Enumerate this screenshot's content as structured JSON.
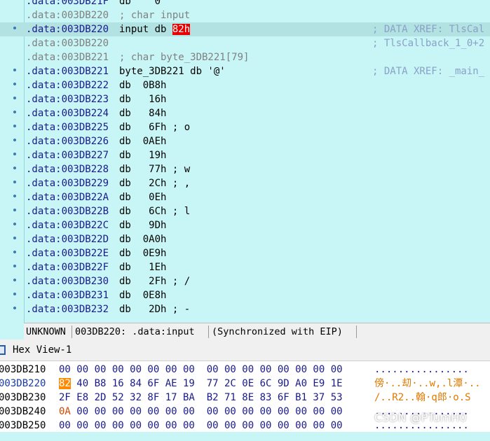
{
  "disassembly": {
    "lines": [
      {
        "addr": ".data:003DB21F",
        "code": "db    0",
        "xref": "",
        "gray": false,
        "dot": false
      },
      {
        "addr": ".data:003DB220",
        "code": "; char input",
        "xref": "",
        "gray": true,
        "dot": false
      },
      {
        "addr": ".data:003DB220",
        "code": "input db ",
        "sel": "82h",
        "xref": "; DATA XREF: TlsCal",
        "gray": false,
        "dot": true,
        "hl": true
      },
      {
        "addr": ".data:003DB220",
        "code": "",
        "xref": "; TlsCallback_1_0+2",
        "gray": true,
        "dot": false
      },
      {
        "addr": ".data:003DB221",
        "code": "; char byte_3DB221[79]",
        "xref": "",
        "gray": true,
        "dot": false
      },
      {
        "addr": ".data:003DB221",
        "code": "byte_3DB221 db '@'",
        "xref": "; DATA XREF: _main_",
        "gray": false,
        "dot": true
      },
      {
        "addr": ".data:003DB222",
        "code": "db  0B8h",
        "xref": "",
        "gray": false,
        "dot": true
      },
      {
        "addr": ".data:003DB223",
        "code": "db   16h",
        "xref": "",
        "gray": false,
        "dot": true
      },
      {
        "addr": ".data:003DB224",
        "code": "db   84h",
        "xref": "",
        "gray": false,
        "dot": true
      },
      {
        "addr": ".data:003DB225",
        "code": "db   6Fh ; o",
        "xref": "",
        "gray": false,
        "dot": true
      },
      {
        "addr": ".data:003DB226",
        "code": "db  0AEh",
        "xref": "",
        "gray": false,
        "dot": true
      },
      {
        "addr": ".data:003DB227",
        "code": "db   19h",
        "xref": "",
        "gray": false,
        "dot": true
      },
      {
        "addr": ".data:003DB228",
        "code": "db   77h ; w",
        "xref": "",
        "gray": false,
        "dot": true
      },
      {
        "addr": ".data:003DB229",
        "code": "db   2Ch ; ,",
        "xref": "",
        "gray": false,
        "dot": true
      },
      {
        "addr": ".data:003DB22A",
        "code": "db   0Eh",
        "xref": "",
        "gray": false,
        "dot": true
      },
      {
        "addr": ".data:003DB22B",
        "code": "db   6Ch ; l",
        "xref": "",
        "gray": false,
        "dot": true
      },
      {
        "addr": ".data:003DB22C",
        "code": "db   9Dh",
        "xref": "",
        "gray": false,
        "dot": true
      },
      {
        "addr": ".data:003DB22D",
        "code": "db  0A0h",
        "xref": "",
        "gray": false,
        "dot": true
      },
      {
        "addr": ".data:003DB22E",
        "code": "db  0E9h",
        "xref": "",
        "gray": false,
        "dot": true
      },
      {
        "addr": ".data:003DB22F",
        "code": "db   1Eh",
        "xref": "",
        "gray": false,
        "dot": true
      },
      {
        "addr": ".data:003DB230",
        "code": "db   2Fh ; /",
        "xref": "",
        "gray": false,
        "dot": true
      },
      {
        "addr": ".data:003DB231",
        "code": "db  0E8h",
        "xref": "",
        "gray": false,
        "dot": true
      },
      {
        "addr": ".data:003DB232",
        "code": "db   2Dh ; -",
        "xref": "",
        "gray": false,
        "dot": true
      }
    ]
  },
  "statusbar": {
    "mode": "UNKNOWN",
    "location": "003DB220: .data:input",
    "sync": "(Synchronized with EIP)"
  },
  "hexview": {
    "title": "Hex View-1",
    "rows": [
      {
        "addr": "003DB210",
        "bytes": "00 00 00 00 00 00 00 00  00 00 00 00 00 00 00 00",
        "ascii": "................",
        "current": false
      },
      {
        "addr": "003DB220",
        "first": "82",
        "bytes": " 40 B8 16 84 6F AE 19  77 2C 0E 6C 9D A0 E9 1E",
        "ascii": "傍·..刧·..w,.l潭·..",
        "current": true
      },
      {
        "addr": "003DB230",
        "bytes": "2F E8 2D 52 32 8F 17 BA  B2 71 8E 83 6F B1 37 53",
        "ascii": "/..R2..翰·q郎·o.S",
        "current": false
      },
      {
        "addr": "003DB240",
        "first": "0A",
        "bytes": " 00 00 00 00 00 00 00  00 00 00 00 00 00 00 00",
        "ascii": "................",
        "current": false
      },
      {
        "addr": "003DB250",
        "bytes": "00 00 00 00 00 00 00 00  00 00 00 00 00 00 00 00",
        "ascii": "................",
        "current": false
      }
    ]
  },
  "watermark": "CSDN @PTumH0",
  "colors": {
    "disasm_bg": "#c8f6f6",
    "highlight_row": "#b2e2e2",
    "selection": "#e80000",
    "hex_selection": "#ff8a00"
  }
}
